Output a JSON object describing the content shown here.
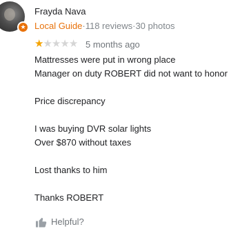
{
  "reviewer": {
    "name": "Frayda Nava",
    "badge": "Local Guide",
    "stats": "·118 reviews·30 photos",
    "avatar_icon": "user-avatar-photo",
    "badge_icon": "local-guide-star-icon"
  },
  "review": {
    "rating": 1,
    "rating_max": 5,
    "time_ago": "5 months ago",
    "lines": [
      "Mattresses were put in wrong place",
      "Manager on duty ROBERT did not want to honor",
      "",
      "Price discrepancy",
      "",
      "I was buying DVR solar lights",
      "Over $870 without taxes",
      "",
      "Lost thanks to him",
      "",
      "Thanks ROBERT"
    ]
  },
  "actions": {
    "helpful_label": "Helpful?",
    "helpful_icon": "thumbs-up-icon"
  },
  "colors": {
    "accent": "#e8710a",
    "star_filled": "#f4a300",
    "star_empty": "#d5d5d5",
    "muted_text": "#70757a"
  }
}
